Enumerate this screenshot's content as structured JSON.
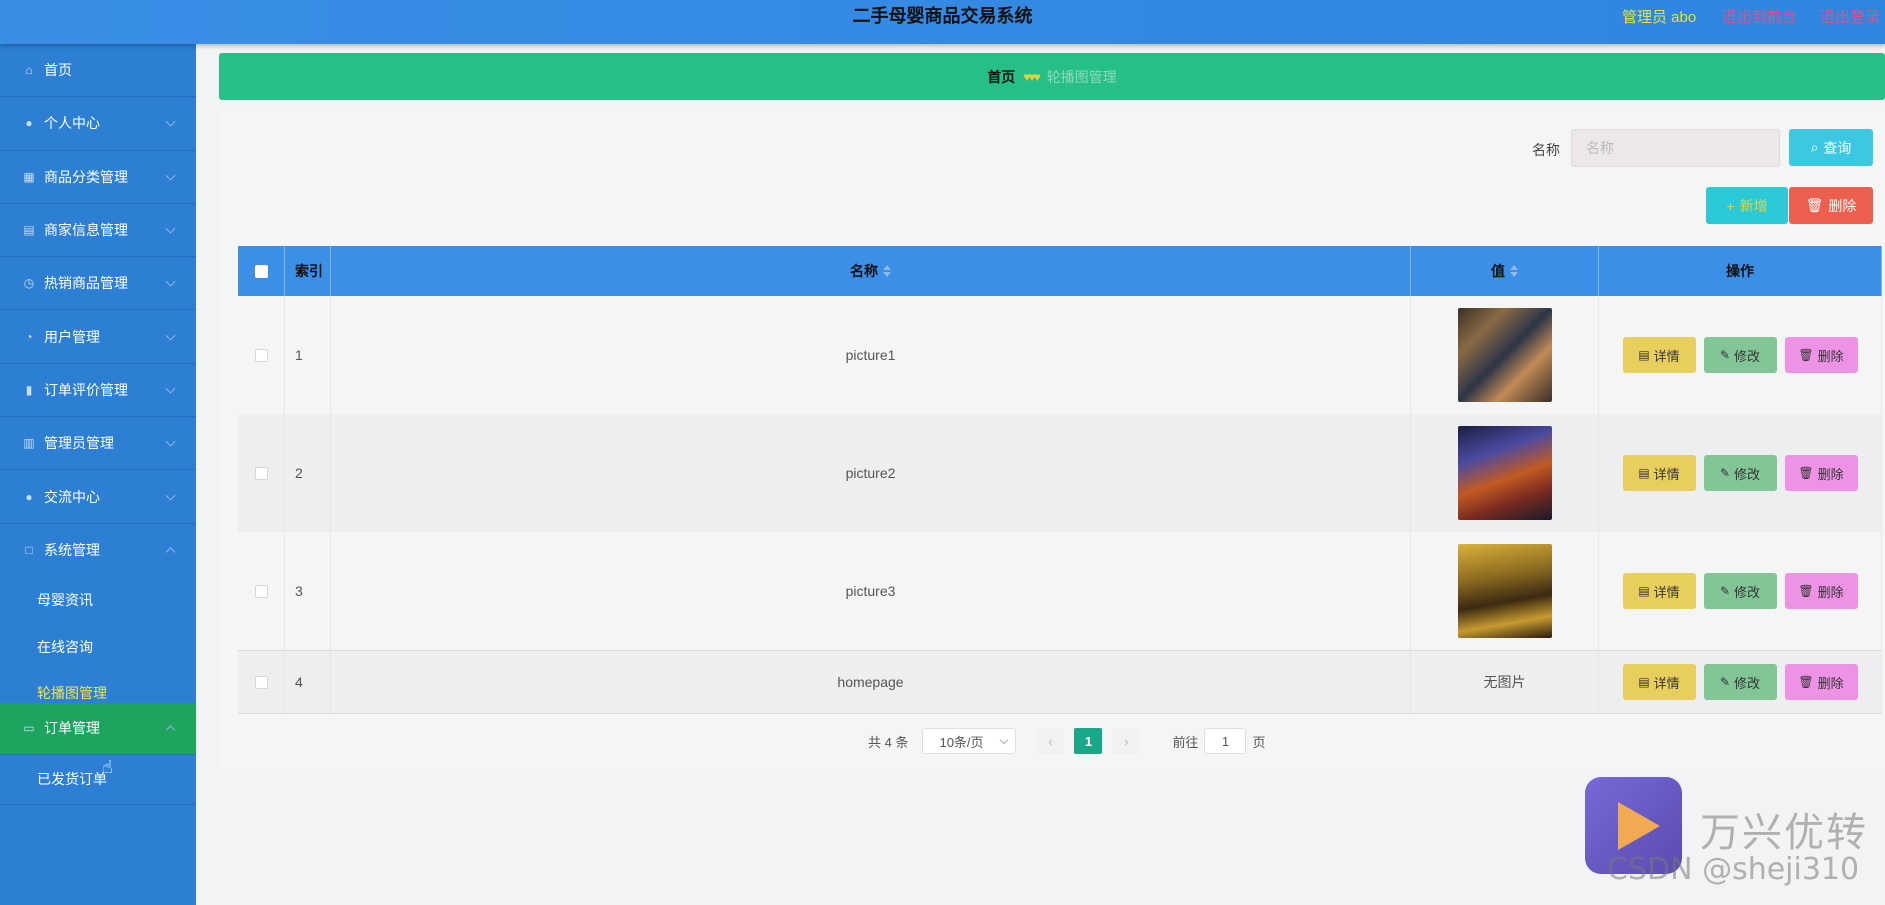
{
  "header": {
    "title": "二手母婴商品交易系统",
    "user": "管理员 abo",
    "back_label": "退出到前台",
    "logout_label": "退出登录"
  },
  "sidebar": {
    "items": [
      {
        "label": "首页",
        "icon": "home-icon"
      },
      {
        "label": "个人中心",
        "icon": "user-icon"
      },
      {
        "label": "商品分类管理",
        "icon": "grid-icon"
      },
      {
        "label": "商家信息管理",
        "icon": "clipboard-icon"
      },
      {
        "label": "热销商品管理",
        "icon": "clock-icon"
      },
      {
        "label": "用户管理",
        "icon": "gauge-icon"
      },
      {
        "label": "订单评价管理",
        "icon": "bar-chart-icon"
      },
      {
        "label": "管理员管理",
        "icon": "building-icon"
      },
      {
        "label": "交流中心",
        "icon": "user-icon"
      },
      {
        "label": "系统管理",
        "icon": "square-icon"
      }
    ],
    "system_sub": [
      "母婴资讯",
      "在线咨询",
      "轮播图管理"
    ],
    "order_menu": {
      "label": "订单管理",
      "icon": "monitor-icon"
    },
    "order_sub": [
      "已发货订单"
    ]
  },
  "breadcrumb": {
    "home": "首页",
    "separator": "♥♥♥",
    "current": "轮播图管理"
  },
  "search": {
    "label": "名称",
    "placeholder": "名称",
    "query_label": "查询"
  },
  "toolbar": {
    "add_label": "新增",
    "delete_label": "删除"
  },
  "table": {
    "columns": [
      "索引",
      "名称",
      "值",
      "操作"
    ],
    "rows": [
      {
        "index": "1",
        "name": "picture1",
        "value": "image"
      },
      {
        "index": "2",
        "name": "picture2",
        "value": "image"
      },
      {
        "index": "3",
        "name": "picture3",
        "value": "image"
      },
      {
        "index": "4",
        "name": "homepage",
        "value": "无图片"
      }
    ],
    "actions": {
      "detail": "详情",
      "edit": "修改",
      "delete": "删除"
    }
  },
  "pagination": {
    "total": "共 4 条",
    "page_size": "10条/页",
    "current_page": "1",
    "goto_label": "前往",
    "goto_value": "1",
    "page_unit": "页"
  },
  "watermark": {
    "brand": "万兴优转",
    "credit": "CSDN @sheji310"
  },
  "colors": {
    "header": "#3a8ee6",
    "sidebar": "#2d7fd3",
    "breadcrumb": "#25bf87",
    "table_header": "#3b8fe6",
    "active_menu": "#1fa45f"
  }
}
